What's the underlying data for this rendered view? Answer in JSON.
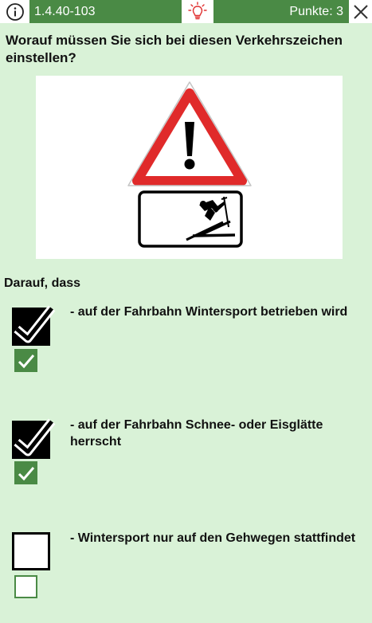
{
  "header": {
    "question_id": "1.4.40-103",
    "points": "Punkte: 3",
    "accent_color": "#4a8a45",
    "info_icon": "info-circle-icon",
    "hint_icon": "lightbulb-icon",
    "close_icon": "close-icon"
  },
  "question": {
    "text": "Worauf müssen Sie sich bei diesen Verkehrszeichen einstellen?",
    "image": {
      "description_icons": [
        "warning-triangle-icon",
        "skier-icon"
      ]
    }
  },
  "answers_intro": "Darauf, dass",
  "answers": [
    {
      "text": "- auf der Fahrbahn Wintersport betrieben wird",
      "selected": true,
      "correct": true
    },
    {
      "text": "- auf der Fahrbahn Schnee- oder Eisglätte herrscht",
      "selected": true,
      "correct": true
    },
    {
      "text": "- Wintersport nur auf den Gehwegen stattfindet",
      "selected": false,
      "correct": false
    }
  ],
  "background_color": "#d9f2d7"
}
